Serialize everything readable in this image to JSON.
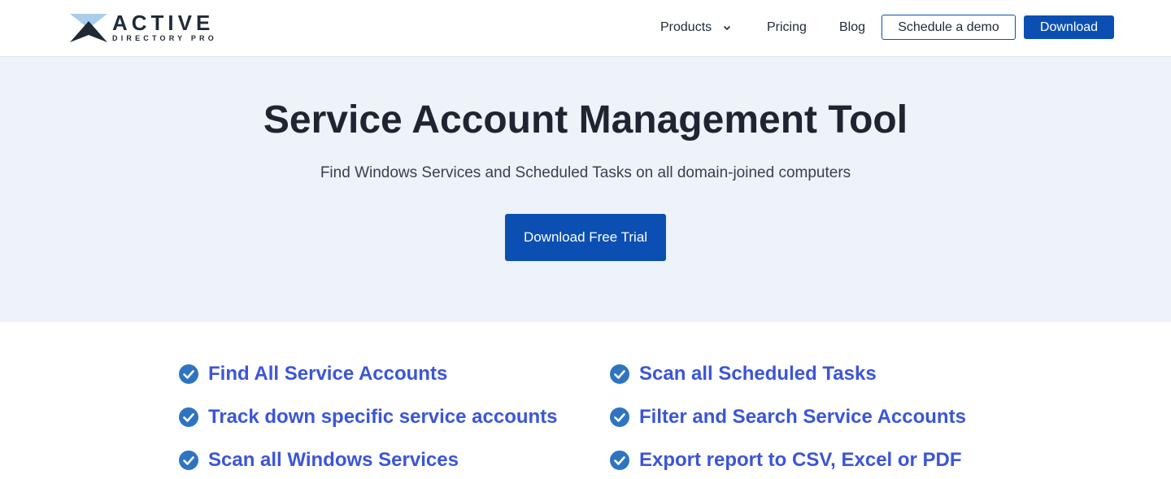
{
  "header": {
    "logo": {
      "title": "ACTIVE",
      "subtitle": "DIRECTORY PRO"
    },
    "nav": {
      "products": "Products",
      "pricing": "Pricing",
      "blog": "Blog"
    },
    "schedule_demo": "Schedule a demo",
    "download": "Download"
  },
  "hero": {
    "title": "Service Account Management Tool",
    "subtitle": "Find Windows Services and Scheduled Tasks on all domain-joined computers",
    "cta": "Download Free Trial"
  },
  "features": {
    "left": [
      "Find All Service Accounts",
      "Track down specific service accounts",
      "Scan all Windows Services"
    ],
    "right": [
      "Scan all Scheduled Tasks",
      "Filter and Search Service Accounts",
      "Export report to CSV, Excel or PDF"
    ]
  },
  "icons": {
    "logo": "active-directory-pro-logo-icon",
    "products_dropdown": "chevron-down-icon",
    "feature": "check-circle-icon"
  },
  "colors": {
    "brand_blue": "#0b4fb3",
    "feature_text": "#3b55d9",
    "hero_bg": "#eef2f9",
    "check_blue": "#2f74c0"
  }
}
